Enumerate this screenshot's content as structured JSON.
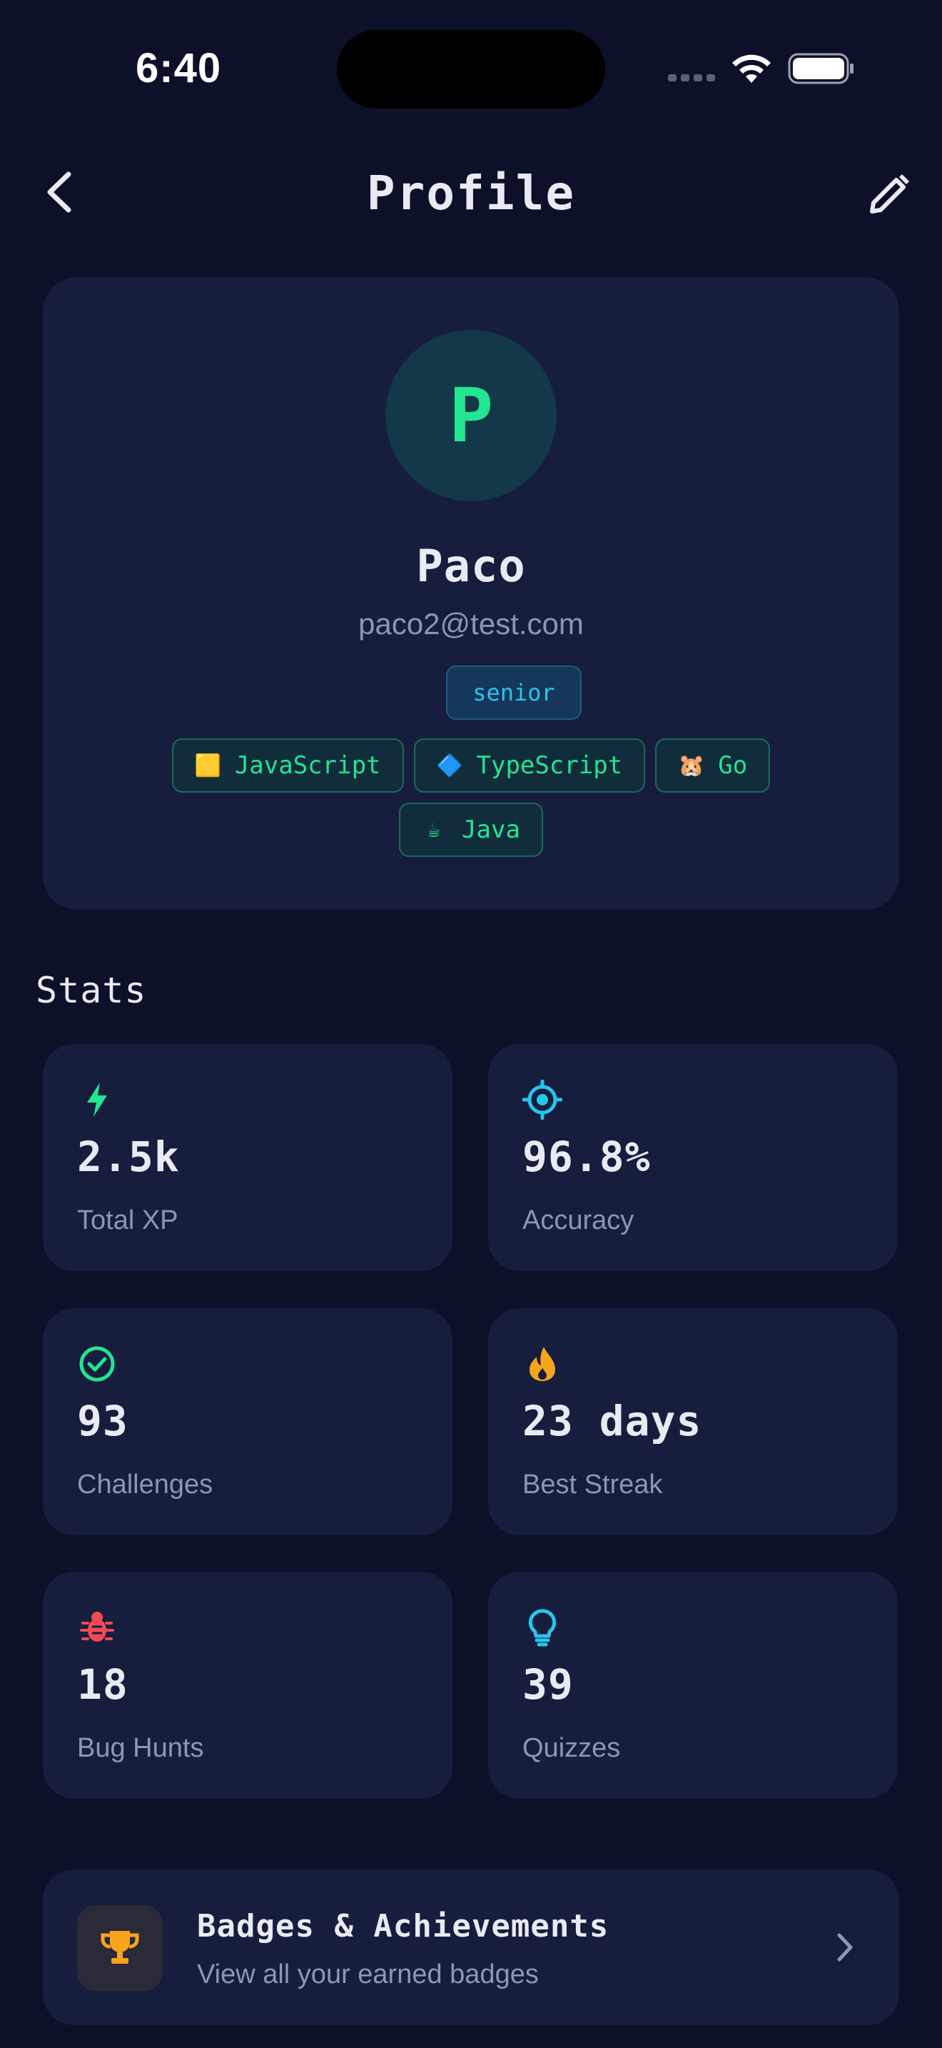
{
  "status_bar": {
    "time": "6:40"
  },
  "header": {
    "title": "Profile"
  },
  "profile": {
    "avatar_initial": "P",
    "name": "Paco",
    "email": "paco2@test.com",
    "level": "senior",
    "languages": [
      {
        "emoji": "🟨",
        "name": "JavaScript"
      },
      {
        "emoji": "🔷",
        "name": "TypeScript"
      },
      {
        "emoji": "🐹",
        "name": "Go"
      },
      {
        "emoji": "☕",
        "name": "Java"
      }
    ]
  },
  "stats": {
    "title": "Stats",
    "items": [
      {
        "icon": "lightning-icon",
        "color": "#22e58f",
        "value": "2.5k",
        "label": "Total XP"
      },
      {
        "icon": "target-icon",
        "color": "#27c6ec",
        "value": "96.8%",
        "label": "Accuracy"
      },
      {
        "icon": "check-circle-icon",
        "color": "#22e58f",
        "value": "93",
        "label": "Challenges"
      },
      {
        "icon": "flame-icon",
        "color": "#f7a41d",
        "value": "23 days",
        "label": "Best Streak"
      },
      {
        "icon": "bug-icon",
        "color": "#f04a55",
        "value": "18",
        "label": "Bug Hunts"
      },
      {
        "icon": "lightbulb-icon",
        "color": "#27c6ec",
        "value": "39",
        "label": "Quizzes"
      }
    ]
  },
  "badges": {
    "title": "Badges & Achievements",
    "subtitle": "View all your earned badges"
  },
  "colors": {
    "background": "#0c1028",
    "card": "#161d3d",
    "accent_green": "#22e58f",
    "accent_cyan": "#27c6ec",
    "muted_text": "#8e96b2"
  }
}
